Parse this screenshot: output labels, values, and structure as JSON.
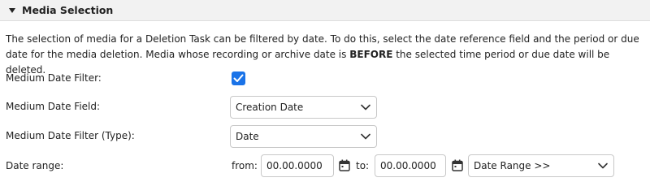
{
  "section": {
    "title": "Media Selection"
  },
  "description": {
    "part1": "The selection of media for a Deletion Task can be filtered by date. To do this, select the date reference field and the period or due date for the media deletion. Media whose recording or archive date is ",
    "emphasis": "BEFORE",
    "part2": " the selected time period or due date will be deleted."
  },
  "fields": {
    "date_filter": {
      "label": "Medium Date Filter:",
      "checked": true
    },
    "date_field": {
      "label": "Medium Date Field:",
      "value": "Creation Date"
    },
    "filter_type": {
      "label": "Medium Date Filter (Type):",
      "value": "Date"
    },
    "date_range": {
      "label": "Date range:",
      "from_label": "from:",
      "from_value": "00.00.0000",
      "to_label": "to:",
      "to_value": "00.00.0000",
      "range_value": "Date Range >>"
    }
  },
  "colors": {
    "accent": "#1a73e8",
    "header_bg": "#f2f2f2",
    "border": "#c8c8c8"
  }
}
